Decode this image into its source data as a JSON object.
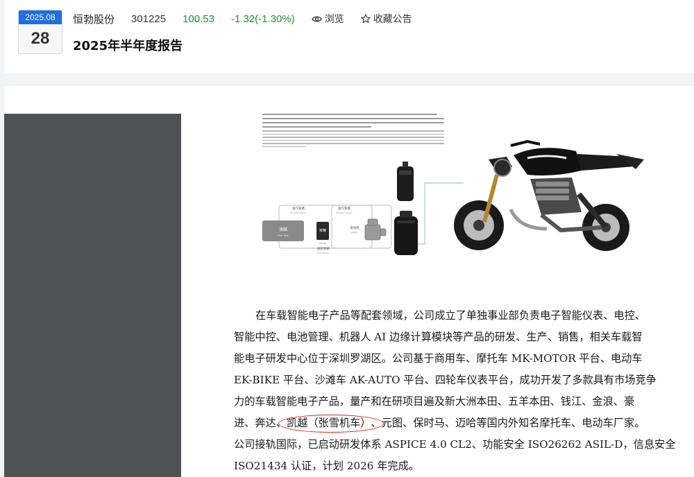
{
  "header": {
    "date_badge": {
      "year_month": "2025.08",
      "day": "28"
    },
    "stock": {
      "name": "恒勃股份",
      "code": "301225",
      "price": "100.53",
      "change": "-1.32(-1.30%)"
    },
    "actions": {
      "browse_label": "浏览",
      "favorite_label": "收藏公告"
    },
    "document_title": "2025年半年度报告"
  },
  "colors": {
    "badge_blue": "#1f6fe0",
    "price_green": "#1e8b3a",
    "side_panel": "#4f5255",
    "annotation_red": "#d42222"
  },
  "figure": {
    "diagram_labels": {
      "oil_vapor_pipeline_1": "油气管路",
      "oil_vapor_pipeline_1_en": "Oil Vapor Pipeline",
      "oil_vapor_pipeline_2": "油气管路",
      "oil_vapor_pipeline_2_en": "Oil Vapor Pipeline",
      "fuel_tank": "油箱",
      "fuel_tank_en": "Fuel Tank",
      "carbon_canister": "炭罐",
      "carbon_canister_en": "Canister",
      "engine": "发动机",
      "engine_en": "Engine",
      "desorption_pipeline": "脱附管路",
      "desorption_pipeline_en": "Fuel Pipeline"
    }
  },
  "body": {
    "lines": [
      "在车载智能电子产品等配套领域，公司成立了单独事业部负责电子智能仪表、电控、",
      "智能中控、电池管理、机器人 AI 边缘计算模块等产品的研发、生产、销售，相关车载智",
      "能电子研发中心位于深圳罗湖区。公司基于商用车、摩托车 MK-MOTOR 平台、电动车",
      "EK-BIKE 平台、沙滩车 AK-AUTO 平台、四轮车仪表平台，成功开发了多款具有市场竞争",
      "力的车载智能电子产品，量产和在研项目遍及新大洲本田、五羊本田、钱江、金浪、豪"
    ],
    "line6_before": "进、奔达、",
    "line6_circled": "凯越（张雪机车）",
    "line6_after": "、元图、保时马、迈哈等国内外知名摩托车、电动车厂家。",
    "lines_after": [
      "公司接轨国际，已启动研发体系 ASPICE 4.0 CL2、功能安全 ISO26262 ASIL-D，信息安全",
      "ISO21434 认证，计划 2026 年完成。"
    ]
  }
}
